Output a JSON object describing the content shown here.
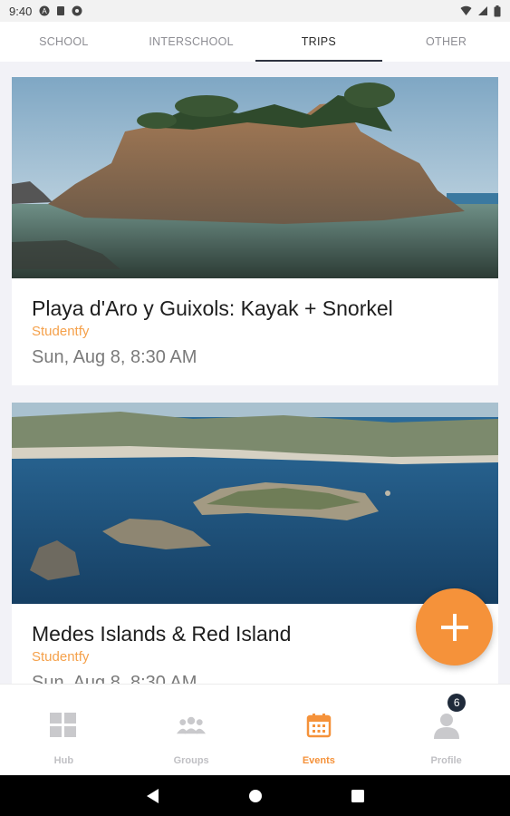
{
  "status_bar": {
    "time": "9:40"
  },
  "tabs": [
    {
      "label": "SCHOOL"
    },
    {
      "label": "INTERSCHOOL"
    },
    {
      "label": "TRIPS"
    },
    {
      "label": "OTHER"
    }
  ],
  "active_tab": "TRIPS",
  "events": [
    {
      "title": "Playa d'Aro y Guixols: Kayak + Snorkel",
      "organizer": "Studentfy",
      "date": "Sun, Aug 8, 8:30 AM"
    },
    {
      "title": "Medes Islands & Red Island",
      "organizer": "Studentfy",
      "date": "Sun, Aug 8, 8:30 AM"
    }
  ],
  "bottom_nav": [
    {
      "label": "Hub"
    },
    {
      "label": "Groups"
    },
    {
      "label": "Events"
    },
    {
      "label": "Profile",
      "badge": "6"
    }
  ],
  "colors": {
    "accent": "#f5923a",
    "organizer": "#f5a14b",
    "badge": "#1f2a3a"
  },
  "icons": {
    "fab": "plus-icon",
    "hub": "grid-icon",
    "groups": "people-icon",
    "events": "calendar-icon",
    "profile": "person-icon"
  }
}
